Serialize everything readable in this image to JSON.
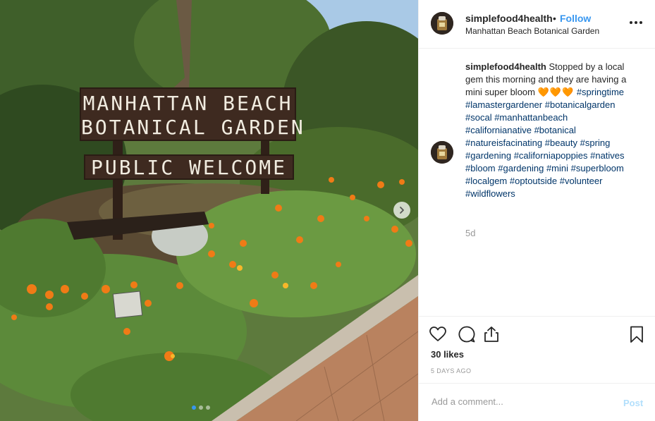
{
  "post": {
    "username": "simplefood4health",
    "separator": "•",
    "follow_label": "Follow",
    "location": "Manhattan Beach Botanical Garden",
    "more_icon": "more-options-icon"
  },
  "photo": {
    "sign": {
      "line1": "MANHATTAN BEACH",
      "line2": "BOTANICAL GARDEN",
      "line3": "PUBLIC WELCOME"
    },
    "carousel_dots": 3,
    "active_dot": 0,
    "next_icon": "chevron-right-icon"
  },
  "caption": {
    "username": "simplefood4health",
    "text": "Stopped by a local gem this morning and they are having a mini super bloom",
    "emoji": "🧡🧡🧡",
    "hashtags": [
      "#springtime",
      "#lamastergardener",
      "#botanicalgarden",
      "#socal",
      "#manhattanbeach",
      "#californianative",
      "#botanical",
      "#natureisfacinating",
      "#beauty",
      "#spring",
      "#gardening",
      "#californiapoppies",
      "#natives",
      "#bloom",
      "#gardening",
      "#mini",
      "#superbloom",
      "#localgem",
      "#optoutside",
      "#volunteer",
      "#wildflowers"
    ],
    "age": "5d"
  },
  "actions": {
    "likes": "30 likes",
    "posted_ago": "5 DAYS AGO"
  },
  "comment_box": {
    "placeholder": "Add a comment...",
    "post_label": "Post"
  },
  "colors": {
    "link_blue": "#3897f0",
    "hashtag": "#003569",
    "muted": "#999999",
    "post_disabled": "#b2dffc"
  }
}
